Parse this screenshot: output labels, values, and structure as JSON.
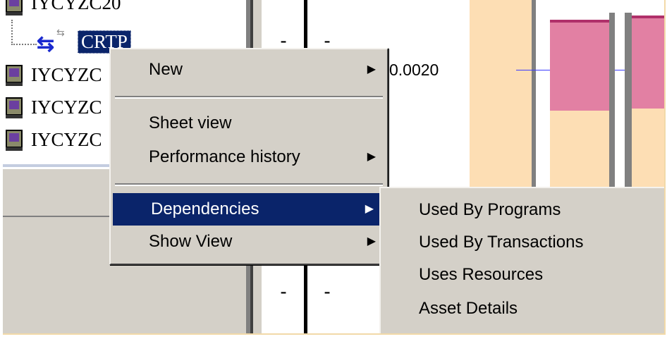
{
  "tree": {
    "items": [
      {
        "label": "IYCYZC20"
      },
      {
        "label": "CRTP"
      },
      {
        "label": "IYCYZC"
      },
      {
        "label": "IYCYZC"
      },
      {
        "label": "IYCYZC"
      }
    ]
  },
  "table": {
    "cells_top": [
      "-",
      "-"
    ],
    "value": "0.0020",
    "cells_bottom": [
      "-",
      "-"
    ]
  },
  "chart_data": {
    "type": "bar",
    "colors": {
      "upper": "#e280a3",
      "lower": "#fddeb4",
      "line": "#3a3aff"
    }
  },
  "context_menu": {
    "items": [
      {
        "label": "New",
        "submenu": true
      },
      {
        "label": "Sheet view",
        "submenu": false
      },
      {
        "label": "Performance history",
        "submenu": true
      },
      {
        "label": "Dependencies",
        "submenu": true
      },
      {
        "label": "Show View",
        "submenu": true
      }
    ]
  },
  "dependencies_submenu": {
    "items": [
      {
        "label": "Used By Programs"
      },
      {
        "label": "Used By Transactions"
      },
      {
        "label": "Uses Resources"
      },
      {
        "label": "Asset Details"
      }
    ]
  },
  "colors": {
    "selection": "#0a246a",
    "menu_bg": "#d4d0c8"
  }
}
